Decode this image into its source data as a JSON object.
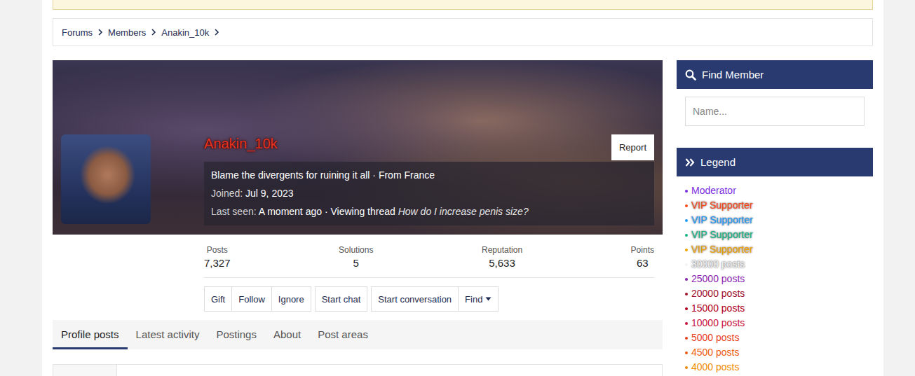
{
  "breadcrumb": [
    {
      "label": "Forums"
    },
    {
      "label": "Members"
    },
    {
      "label": "Anakin_10k"
    }
  ],
  "profile": {
    "username": "Anakin_10k",
    "report": "Report",
    "tagline": "Blame the divergents for ruining it all · From France",
    "joined_label": "Joined:",
    "joined": "Jul 9, 2023",
    "last_seen_label": "Last seen:",
    "last_seen": "A moment ago · Viewing thread",
    "thread": "How do I increase penis size?"
  },
  "stats": [
    {
      "label": "Posts",
      "value": "7,327"
    },
    {
      "label": "Solutions",
      "value": "5"
    },
    {
      "label": "Reputation",
      "value": "5,633"
    },
    {
      "label": "Points",
      "value": "63"
    }
  ],
  "actions": [
    {
      "buttons": [
        {
          "label": "Gift",
          "dropdown": false
        },
        {
          "label": "Follow",
          "dropdown": false
        },
        {
          "label": "Ignore",
          "dropdown": false
        }
      ]
    },
    {
      "buttons": [
        {
          "label": "Start chat",
          "dropdown": false
        }
      ]
    },
    {
      "buttons": [
        {
          "label": "Start conversation",
          "dropdown": false
        },
        {
          "label": "Find",
          "dropdown": true
        }
      ]
    }
  ],
  "tabs": [
    {
      "label": "Profile posts",
      "selected": true
    },
    {
      "label": "Latest activity",
      "selected": false
    },
    {
      "label": "Postings",
      "selected": false
    },
    {
      "label": "About",
      "selected": false
    },
    {
      "label": "Post areas",
      "selected": false
    }
  ],
  "sidebar": {
    "find_member": {
      "title": "Find Member",
      "placeholder": "Name..."
    },
    "legend": {
      "title": "Legend",
      "items": [
        {
          "label": "Moderator",
          "color": "#7b2be0",
          "kind": "plain"
        },
        {
          "label": "VIP Supporter",
          "color": "#ff4a1a",
          "kind": "glow"
        },
        {
          "label": "VIP Supporter",
          "color": "#1a9cff",
          "kind": "glow"
        },
        {
          "label": "VIP Supporter",
          "color": "#10b585",
          "kind": "glow"
        },
        {
          "label": "VIP Supporter",
          "color": "#f5a500",
          "kind": "glow"
        },
        {
          "label": "30000 posts",
          "color": "#f4f4f4",
          "kind": "glow"
        },
        {
          "label": "25000 posts",
          "color": "#8a1fb0",
          "kind": "plain"
        },
        {
          "label": "20000 posts",
          "color": "#a0102a",
          "kind": "plain"
        },
        {
          "label": "15000 posts",
          "color": "#b0001a",
          "kind": "plain"
        },
        {
          "label": "10000 posts",
          "color": "#c8103a",
          "kind": "plain"
        },
        {
          "label": "5000 posts",
          "color": "#e8401c",
          "kind": "plain"
        },
        {
          "label": "4500 posts",
          "color": "#ec5a10",
          "kind": "plain"
        },
        {
          "label": "4000 posts",
          "color": "#f08a00",
          "kind": "plain"
        }
      ]
    }
  }
}
